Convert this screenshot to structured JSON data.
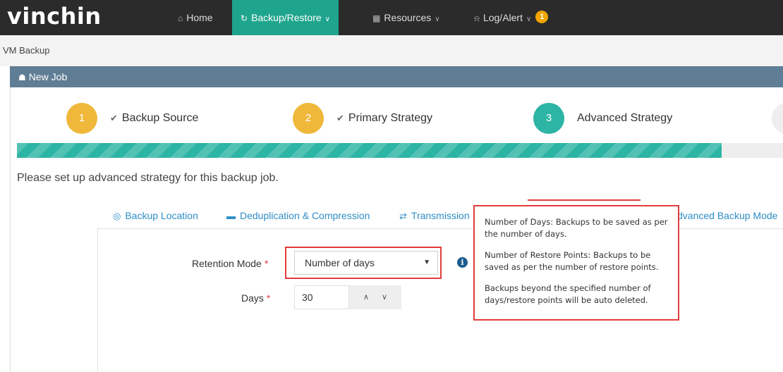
{
  "nav": {
    "logo": "vinchin",
    "items": [
      {
        "label": "Home",
        "icon": "home-icon"
      },
      {
        "label": "Backup/Restore",
        "icon": "refresh-icon",
        "active": true
      },
      {
        "label": "Resources",
        "icon": "grid-icon"
      },
      {
        "label": "Log/Alert",
        "icon": "bell-icon",
        "badge": "1"
      }
    ]
  },
  "breadcrumb": "VM Backup",
  "panel": {
    "title": "New Job"
  },
  "steps": [
    {
      "number": "1",
      "label": "Backup Source",
      "status": "done"
    },
    {
      "number": "2",
      "label": "Primary Strategy",
      "status": "done"
    },
    {
      "number": "3",
      "label": "Advanced Strategy",
      "status": "current"
    }
  ],
  "progress": 0.92,
  "intro": "Please set up advanced strategy for this backup job.",
  "tabs": [
    {
      "label": "Backup Location",
      "icon": "location-icon"
    },
    {
      "label": "Deduplication & Compression",
      "icon": "drive-icon"
    },
    {
      "label": "Transmission",
      "icon": "exchange-icon"
    },
    {
      "label": "dvanced Backup Mode"
    }
  ],
  "form": {
    "retention_label": "Retention Mode",
    "retention_value": "Number of days",
    "days_label": "Days",
    "days_value": "30",
    "required_mark": "*"
  },
  "tooltip": {
    "lines": [
      "Number of Days: Backups to be saved as per the number of days.",
      "Number of Restore Points: Backups to be saved as per the number of restore points.",
      "Backups beyond the specified number of days/restore points will be auto deleted."
    ]
  },
  "colors": {
    "nav_bg": "#2b2b2b",
    "accent": "#1fa58d",
    "step_done": "#f0b83a",
    "step_current": "#2cb4a4",
    "panel_header": "#5f7d95",
    "link": "#2f8ec5",
    "highlight": "#e23c3c"
  }
}
